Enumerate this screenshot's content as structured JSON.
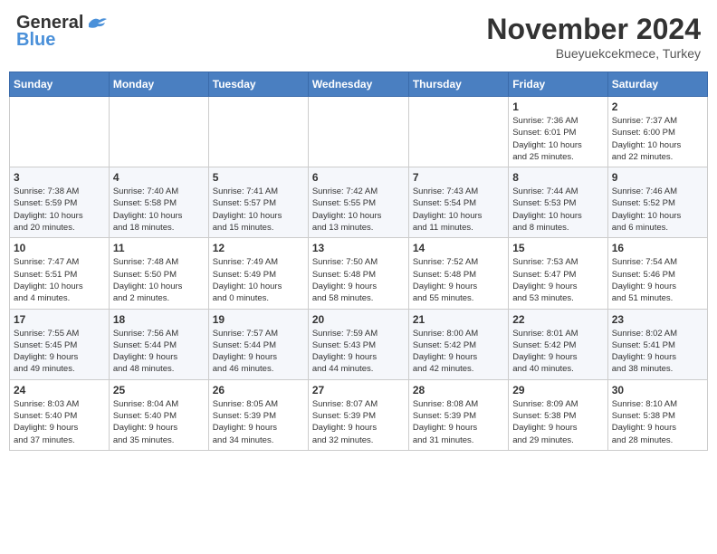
{
  "header": {
    "logo_line1": "General",
    "logo_line2": "Blue",
    "month": "November 2024",
    "location": "Bueyuekcekmece, Turkey"
  },
  "weekdays": [
    "Sunday",
    "Monday",
    "Tuesday",
    "Wednesday",
    "Thursday",
    "Friday",
    "Saturday"
  ],
  "weeks": [
    [
      {
        "day": "",
        "info": ""
      },
      {
        "day": "",
        "info": ""
      },
      {
        "day": "",
        "info": ""
      },
      {
        "day": "",
        "info": ""
      },
      {
        "day": "",
        "info": ""
      },
      {
        "day": "1",
        "info": "Sunrise: 7:36 AM\nSunset: 6:01 PM\nDaylight: 10 hours\nand 25 minutes."
      },
      {
        "day": "2",
        "info": "Sunrise: 7:37 AM\nSunset: 6:00 PM\nDaylight: 10 hours\nand 22 minutes."
      }
    ],
    [
      {
        "day": "3",
        "info": "Sunrise: 7:38 AM\nSunset: 5:59 PM\nDaylight: 10 hours\nand 20 minutes."
      },
      {
        "day": "4",
        "info": "Sunrise: 7:40 AM\nSunset: 5:58 PM\nDaylight: 10 hours\nand 18 minutes."
      },
      {
        "day": "5",
        "info": "Sunrise: 7:41 AM\nSunset: 5:57 PM\nDaylight: 10 hours\nand 15 minutes."
      },
      {
        "day": "6",
        "info": "Sunrise: 7:42 AM\nSunset: 5:55 PM\nDaylight: 10 hours\nand 13 minutes."
      },
      {
        "day": "7",
        "info": "Sunrise: 7:43 AM\nSunset: 5:54 PM\nDaylight: 10 hours\nand 11 minutes."
      },
      {
        "day": "8",
        "info": "Sunrise: 7:44 AM\nSunset: 5:53 PM\nDaylight: 10 hours\nand 8 minutes."
      },
      {
        "day": "9",
        "info": "Sunrise: 7:46 AM\nSunset: 5:52 PM\nDaylight: 10 hours\nand 6 minutes."
      }
    ],
    [
      {
        "day": "10",
        "info": "Sunrise: 7:47 AM\nSunset: 5:51 PM\nDaylight: 10 hours\nand 4 minutes."
      },
      {
        "day": "11",
        "info": "Sunrise: 7:48 AM\nSunset: 5:50 PM\nDaylight: 10 hours\nand 2 minutes."
      },
      {
        "day": "12",
        "info": "Sunrise: 7:49 AM\nSunset: 5:49 PM\nDaylight: 10 hours\nand 0 minutes."
      },
      {
        "day": "13",
        "info": "Sunrise: 7:50 AM\nSunset: 5:48 PM\nDaylight: 9 hours\nand 58 minutes."
      },
      {
        "day": "14",
        "info": "Sunrise: 7:52 AM\nSunset: 5:48 PM\nDaylight: 9 hours\nand 55 minutes."
      },
      {
        "day": "15",
        "info": "Sunrise: 7:53 AM\nSunset: 5:47 PM\nDaylight: 9 hours\nand 53 minutes."
      },
      {
        "day": "16",
        "info": "Sunrise: 7:54 AM\nSunset: 5:46 PM\nDaylight: 9 hours\nand 51 minutes."
      }
    ],
    [
      {
        "day": "17",
        "info": "Sunrise: 7:55 AM\nSunset: 5:45 PM\nDaylight: 9 hours\nand 49 minutes."
      },
      {
        "day": "18",
        "info": "Sunrise: 7:56 AM\nSunset: 5:44 PM\nDaylight: 9 hours\nand 48 minutes."
      },
      {
        "day": "19",
        "info": "Sunrise: 7:57 AM\nSunset: 5:44 PM\nDaylight: 9 hours\nand 46 minutes."
      },
      {
        "day": "20",
        "info": "Sunrise: 7:59 AM\nSunset: 5:43 PM\nDaylight: 9 hours\nand 44 minutes."
      },
      {
        "day": "21",
        "info": "Sunrise: 8:00 AM\nSunset: 5:42 PM\nDaylight: 9 hours\nand 42 minutes."
      },
      {
        "day": "22",
        "info": "Sunrise: 8:01 AM\nSunset: 5:42 PM\nDaylight: 9 hours\nand 40 minutes."
      },
      {
        "day": "23",
        "info": "Sunrise: 8:02 AM\nSunset: 5:41 PM\nDaylight: 9 hours\nand 38 minutes."
      }
    ],
    [
      {
        "day": "24",
        "info": "Sunrise: 8:03 AM\nSunset: 5:40 PM\nDaylight: 9 hours\nand 37 minutes."
      },
      {
        "day": "25",
        "info": "Sunrise: 8:04 AM\nSunset: 5:40 PM\nDaylight: 9 hours\nand 35 minutes."
      },
      {
        "day": "26",
        "info": "Sunrise: 8:05 AM\nSunset: 5:39 PM\nDaylight: 9 hours\nand 34 minutes."
      },
      {
        "day": "27",
        "info": "Sunrise: 8:07 AM\nSunset: 5:39 PM\nDaylight: 9 hours\nand 32 minutes."
      },
      {
        "day": "28",
        "info": "Sunrise: 8:08 AM\nSunset: 5:39 PM\nDaylight: 9 hours\nand 31 minutes."
      },
      {
        "day": "29",
        "info": "Sunrise: 8:09 AM\nSunset: 5:38 PM\nDaylight: 9 hours\nand 29 minutes."
      },
      {
        "day": "30",
        "info": "Sunrise: 8:10 AM\nSunset: 5:38 PM\nDaylight: 9 hours\nand 28 minutes."
      }
    ]
  ]
}
